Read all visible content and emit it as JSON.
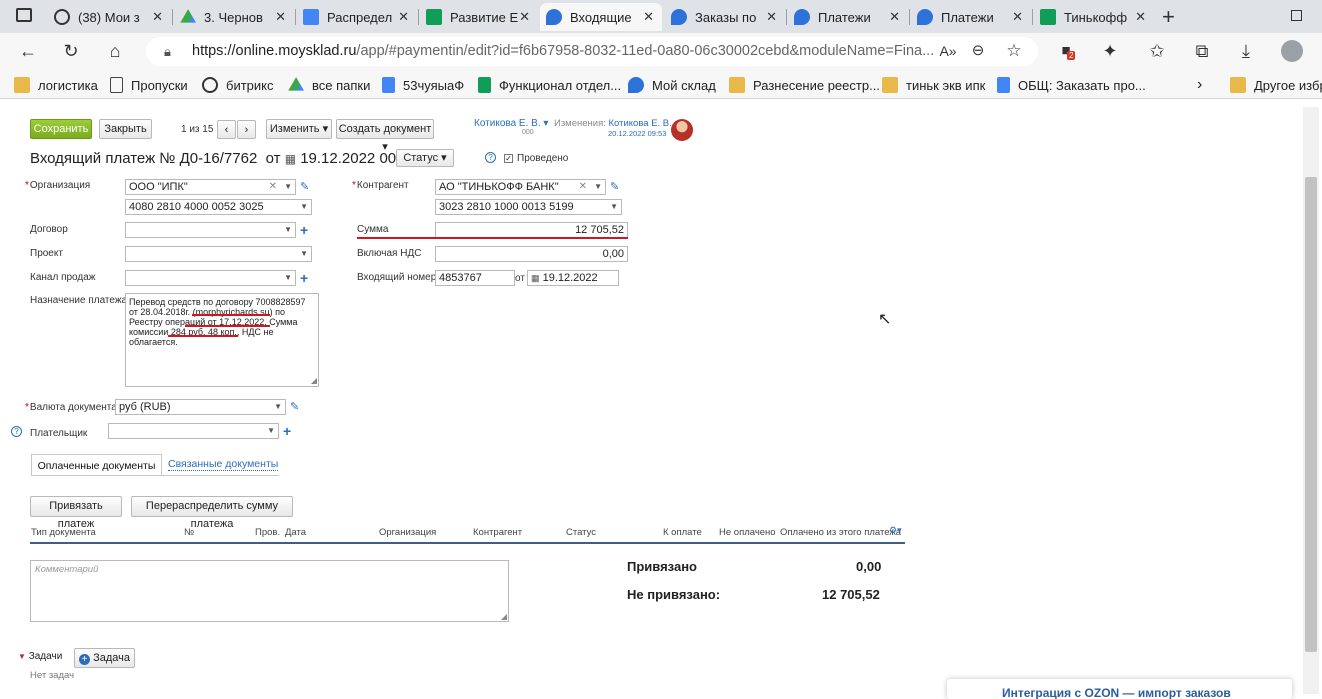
{
  "browser": {
    "tabs": [
      {
        "label": "(38) Мои з",
        "icon": "circle-arrow-icon",
        "color": "#333333"
      },
      {
        "label": "3. Чернов",
        "icon": "google-drive-icon",
        "color": "#34a853"
      },
      {
        "label": "Распредел",
        "icon": "google-docs-icon",
        "color": "#4285f4"
      },
      {
        "label": "Развитие Е",
        "icon": "google-sheets-icon",
        "color": "#0f9d58"
      },
      {
        "label": "Входящие",
        "icon": "moysklad-icon",
        "color": "#2d72d9"
      },
      {
        "label": "Заказы по",
        "icon": "moysklad-icon",
        "color": "#2d72d9"
      },
      {
        "label": "Платежи",
        "icon": "moysklad-icon",
        "color": "#2d72d9"
      },
      {
        "label": "Платежи",
        "icon": "moysklad-icon",
        "color": "#2d72d9"
      },
      {
        "label": "Тинькофф",
        "icon": "google-sheets-icon",
        "color": "#0f9d58"
      }
    ],
    "url_base": "https://online.moysklad.ru",
    "url_rest": "/app/#paymentin/edit?id=f6b67958-8032-11ed-0a80-06c30002cebd&moduleName=Fina...",
    "extension_badge": "2",
    "bookmarks": [
      {
        "label": "логистика",
        "icon": "folder-icon"
      },
      {
        "label": "Пропуски",
        "icon": "page-icon"
      },
      {
        "label": "битрикс",
        "icon": "circle-arrow-icon"
      },
      {
        "label": "все папки",
        "icon": "google-drive-icon"
      },
      {
        "label": "53чуяыаФ",
        "icon": "google-docs-icon"
      },
      {
        "label": "Функционал отдел...",
        "icon": "google-sheets-icon"
      },
      {
        "label": "Мой склад",
        "icon": "moysklad-icon"
      },
      {
        "label": "Разнесение реестр...",
        "icon": "folder-icon"
      },
      {
        "label": "тиньк экв ипк",
        "icon": "folder-icon"
      },
      {
        "label": "ОБЩ: Заказать про...",
        "icon": "google-docs-icon"
      }
    ],
    "other_bookmarks": "Другое избр"
  },
  "toolbar": {
    "save": "Сохранить",
    "close": "Закрыть",
    "pager": "1 из 15",
    "change": "Изменить",
    "create_doc": "Создать документ",
    "owner": "Котикова Е. В.",
    "owner_sub": "000",
    "changes_label": "Изменения:",
    "changes_user": "Котикова Е. В.",
    "changes_time": "20.12.2022 09:53"
  },
  "doc": {
    "title": "Входящий платеж №",
    "number": "Д0-16/7762",
    "from": "от",
    "date": "19.12.2022 00:00",
    "status": "Статус",
    "posted": "Проведено",
    "help": "?"
  },
  "form": {
    "org_label": "Организация",
    "org_value": "ООО \"ИПК\"",
    "org_account": "4080 2810 4000 0052 3025",
    "contract_label": "Договор",
    "project_label": "Проект",
    "channel_label": "Канал продаж",
    "purpose_label": "Назначение платежа",
    "purpose_value": "Перевод средств по договору 7008828597 от 28.04.2018г. (morphyrichards.su) по Реестру операций от 17.12.2022. Сумма комиссии 284 руб. 48 коп., НДС не облагается.",
    "counterparty_label": "Контрагент",
    "counterparty_value": "АО \"ТИНЬКОФФ БАНК\"",
    "counterparty_account": "3023 2810 1000 0013 5199",
    "sum_label": "Сумма",
    "sum_value": "12 705,52",
    "vat_label": "Включая НДС",
    "vat_value": "0,00",
    "incoming_label": "Входящий номер",
    "incoming_value": "4853767",
    "incoming_from": "от",
    "incoming_date": "19.12.2022",
    "currency_label": "Валюта документа",
    "currency_value": "руб (RUB)",
    "payer_label": "Плательщик"
  },
  "tabs": {
    "paid": "Оплаченные документы",
    "linked": "Связанные документы"
  },
  "actions": {
    "bind": "Привязать платеж",
    "redistribute": "Перераспределить сумму платежа"
  },
  "table": {
    "columns": [
      "Тип документа",
      "№",
      "Пров.",
      "Дата",
      "Организация",
      "Контрагент",
      "Статус",
      "К оплате",
      "Не оплачено",
      "Оплачено из этого платежа"
    ]
  },
  "comment_placeholder": "Комментарий",
  "totals": {
    "bound_label": "Привязано",
    "bound_value": "0,00",
    "unbound_label": "Не привязано:",
    "unbound_value": "12 705,52"
  },
  "tasks": {
    "title": "Задачи",
    "add": "Задача",
    "empty": "Нет задач"
  },
  "promo": "Интеграция с OZON — импорт заказов"
}
